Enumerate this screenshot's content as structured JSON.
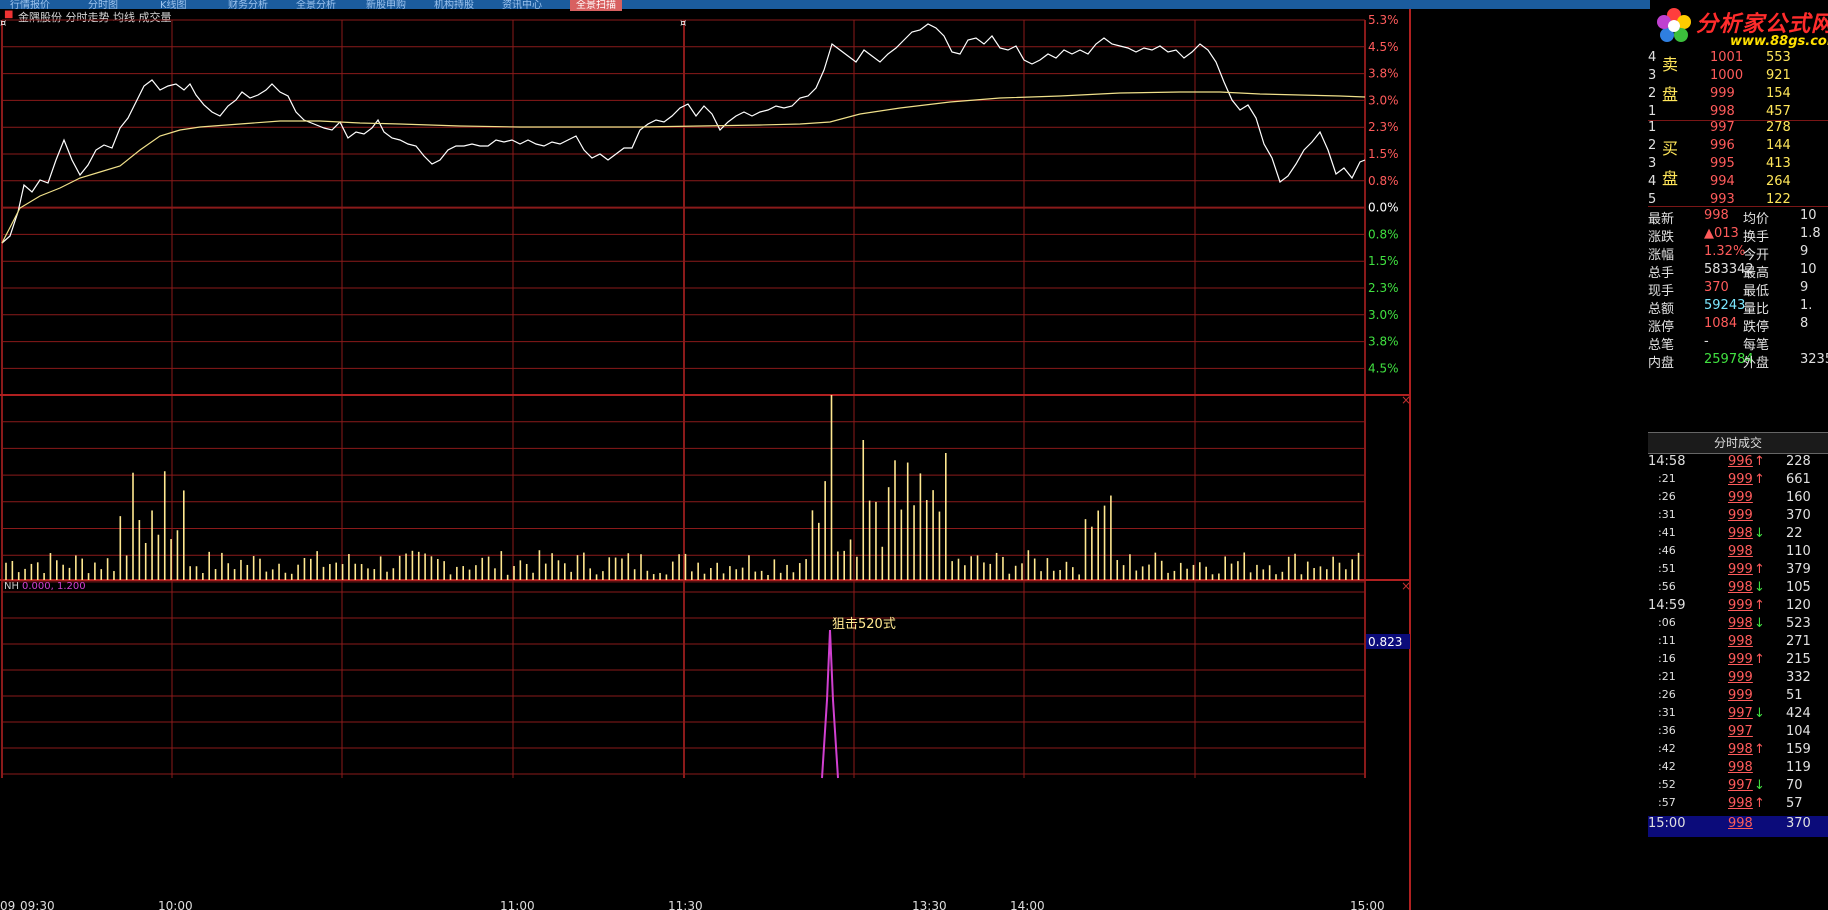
{
  "top_tabs": [
    "行情报价",
    "分时图",
    "K线图",
    "财务分析",
    "全景分析",
    "新股申购",
    "机构持股",
    "资讯中心",
    "全景扫描"
  ],
  "chart_title": "金隅股份 分时走势  均线  成交量",
  "indicator_label": "NH",
  "indicator_params": "0.000, 1.200",
  "indicator_value": "0.823",
  "signal_label": "狙击520式",
  "logo": {
    "name": "分析家公式网",
    "url": "www.88gs.com"
  },
  "price_axis_right": [
    "5.3%",
    "4.5%",
    "3.8%",
    "3.0%",
    "2.3%",
    "1.5%",
    "0.8%",
    "0.0%",
    "0.8%",
    "1.5%",
    "2.3%",
    "3.0%",
    "3.8%",
    "4.5%"
  ],
  "time_axis": [
    "09:30",
    "10:00",
    "11:00",
    "11:30",
    "13:30",
    "14:00",
    "15:00"
  ],
  "time_axis_prefix": "09",
  "sell_label": "卖盘",
  "buy_label": "买盘",
  "sell_orders": [
    {
      "level": "4",
      "price": "1001",
      "vol": "553"
    },
    {
      "level": "3",
      "price": "1000",
      "vol": "921"
    },
    {
      "level": "2",
      "price": "999",
      "vol": "154"
    },
    {
      "level": "1",
      "price": "998",
      "vol": "457"
    }
  ],
  "buy_orders": [
    {
      "level": "1",
      "price": "997",
      "vol": "278"
    },
    {
      "level": "2",
      "price": "996",
      "vol": "144"
    },
    {
      "level": "3",
      "price": "995",
      "vol": "413"
    },
    {
      "level": "4",
      "price": "994",
      "vol": "264"
    },
    {
      "level": "5",
      "price": "993",
      "vol": "122"
    }
  ],
  "stats": [
    {
      "l1": "最新",
      "v1": "998",
      "c1": "red",
      "l2": "均价",
      "v2": "10"
    },
    {
      "l1": "涨跌",
      "v1": "▲013",
      "c1": "red",
      "l2": "换手",
      "v2": "1.8"
    },
    {
      "l1": "涨幅",
      "v1": "1.32%",
      "c1": "red",
      "l2": "今开",
      "v2": "9"
    },
    {
      "l1": "总手",
      "v1": "583342",
      "c1": "white",
      "l2": "最高",
      "v2": "10"
    },
    {
      "l1": "现手",
      "v1": "370",
      "c1": "red",
      "l2": "最低",
      "v2": "9"
    },
    {
      "l1": "总额",
      "v1": "59243",
      "c1": "cyan",
      "l2": "量比",
      "v2": "1."
    },
    {
      "l1": "涨停",
      "v1": "1084",
      "c1": "red",
      "l2": "跌停",
      "v2": "8"
    },
    {
      "l1": "总笔",
      "v1": "-",
      "c1": "white",
      "l2": "每笔",
      "v2": ""
    },
    {
      "l1": "内盘",
      "v1": "259784",
      "c1": "green",
      "l2": "外盘",
      "v2": "3235"
    }
  ],
  "ticks_title": "分时成交",
  "ticks": [
    {
      "time": "14:58",
      "price": "996",
      "dir": "↑",
      "vol": "228"
    },
    {
      "time": ":21",
      "price": "999",
      "dir": "↑",
      "vol": "661"
    },
    {
      "time": ":26",
      "price": "999",
      "dir": "",
      "vol": "160"
    },
    {
      "time": ":31",
      "price": "999",
      "dir": "",
      "vol": "370"
    },
    {
      "time": ":41",
      "price": "998",
      "dir": "↓",
      "vol": "22"
    },
    {
      "time": ":46",
      "price": "998",
      "dir": "",
      "vol": "110"
    },
    {
      "time": ":51",
      "price": "999",
      "dir": "↑",
      "vol": "379"
    },
    {
      "time": ":56",
      "price": "998",
      "dir": "↓",
      "vol": "105"
    },
    {
      "time": "14:59",
      "price": "999",
      "dir": "↑",
      "vol": "120"
    },
    {
      "time": ":06",
      "price": "998",
      "dir": "↓",
      "vol": "523"
    },
    {
      "time": ":11",
      "price": "998",
      "dir": "",
      "vol": "271"
    },
    {
      "time": ":16",
      "price": "999",
      "dir": "↑",
      "vol": "215"
    },
    {
      "time": ":21",
      "price": "999",
      "dir": "",
      "vol": "332"
    },
    {
      "time": ":26",
      "price": "999",
      "dir": "",
      "vol": "51"
    },
    {
      "time": ":31",
      "price": "997",
      "dir": "↓",
      "vol": "424"
    },
    {
      "time": ":36",
      "price": "997",
      "dir": "",
      "vol": "104"
    },
    {
      "time": ":42",
      "price": "998",
      "dir": "↑",
      "vol": "159"
    },
    {
      "time": ":42",
      "price": "998",
      "dir": "",
      "vol": "119"
    },
    {
      "time": ":52",
      "price": "997",
      "dir": "↓",
      "vol": "70"
    },
    {
      "time": ":57",
      "price": "998",
      "dir": "↑",
      "vol": "57"
    },
    {
      "time": "15:00",
      "price": "998",
      "dir": "",
      "vol": "370"
    }
  ],
  "colors": {
    "grid": "#8a1a1a",
    "price": "#ffffff",
    "avg": "#f0e08a",
    "volume": "#ffe890",
    "signal": "#d040d0",
    "up": "#ff5b5b",
    "down": "#40e040"
  }
}
